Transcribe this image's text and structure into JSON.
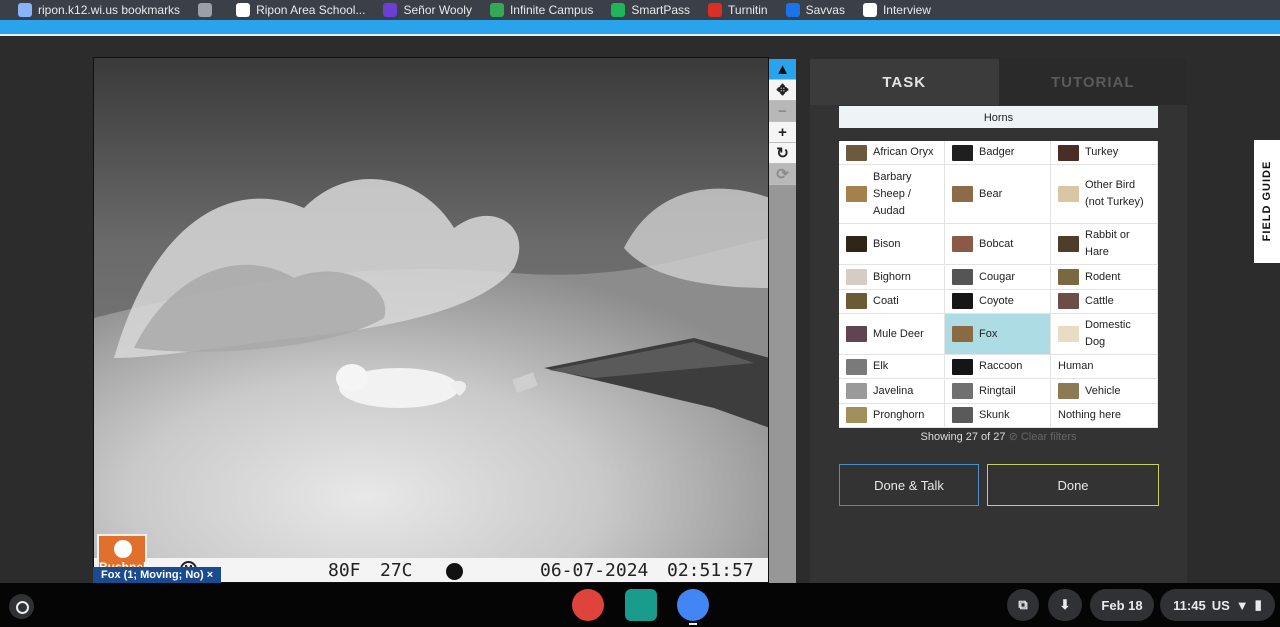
{
  "bookmarks": [
    {
      "label": "ripon.k12.wi.us bookmarks",
      "color": "#8ab4f8"
    },
    {
      "label": "",
      "color": "#9aa0a6"
    },
    {
      "label": "Ripon Area School...",
      "color": "#ffffff"
    },
    {
      "label": "Señor Wooly",
      "color": "#6a3fd2"
    },
    {
      "label": "Infinite Campus",
      "color": "#34a853"
    },
    {
      "label": "SmartPass",
      "color": "#1fb65a"
    },
    {
      "label": "Turnitin",
      "color": "#d93025"
    },
    {
      "label": "Savvas",
      "color": "#1a73e8"
    },
    {
      "label": "Interview",
      "color": "#ffffff"
    }
  ],
  "camera": {
    "temp_f": "80F",
    "temp_c": "27C",
    "date": "06-07-2024",
    "time": "02:51:57",
    "brand": "Bushnell"
  },
  "annotation_label": "Fox (1; Moving; No)",
  "tools": [
    {
      "icon": "pointer-icon",
      "glyph": "▲",
      "active": true
    },
    {
      "icon": "move-icon",
      "glyph": "✥",
      "active": false
    },
    {
      "icon": "zoom-out-icon",
      "glyph": "−",
      "active": false
    },
    {
      "icon": "zoom-in-icon",
      "glyph": "+",
      "active": false
    },
    {
      "icon": "rotate-icon",
      "glyph": "↻",
      "active": false
    },
    {
      "icon": "reset-icon",
      "glyph": "⟳",
      "active": false
    }
  ],
  "tabs": {
    "task": "TASK",
    "tutorial": "TUTORIAL"
  },
  "filter_label": "Horns",
  "species": [
    {
      "name": "African Oryx",
      "thumb": "#6b5a3e",
      "h": 1
    },
    {
      "name": "Badger",
      "thumb": "#1f1f1f",
      "h": 1
    },
    {
      "name": "Turkey",
      "thumb": "#4a2e25",
      "h": 1
    },
    {
      "name": "Barbary Sheep / Audad",
      "thumb": "#a3804c",
      "h": 3
    },
    {
      "name": "Bear",
      "thumb": "#8c6b48",
      "h": 3
    },
    {
      "name": "Other Bird (not Turkey)",
      "thumb": "#d9c7a4",
      "h": 3
    },
    {
      "name": "Bison",
      "thumb": "#2f2618",
      "h": 2
    },
    {
      "name": "Bobcat",
      "thumb": "#8a5a47",
      "h": 2
    },
    {
      "name": "Rabbit or Hare",
      "thumb": "#4e3d28",
      "h": 2
    },
    {
      "name": "Bighorn",
      "thumb": "#d7ccc4",
      "h": 1
    },
    {
      "name": "Cougar",
      "thumb": "#555555",
      "h": 1
    },
    {
      "name": "Rodent",
      "thumb": "#7a6840",
      "h": 1
    },
    {
      "name": "Coati",
      "thumb": "#6a5b36",
      "h": 1
    },
    {
      "name": "Coyote",
      "thumb": "#161616",
      "h": 1
    },
    {
      "name": "Cattle",
      "thumb": "#6d4d48",
      "h": 1
    },
    {
      "name": "Mule Deer",
      "thumb": "#5e4550",
      "h": 2
    },
    {
      "name": "Fox",
      "thumb": "#8a6a42",
      "h": 2,
      "selected": true
    },
    {
      "name": "Domestic Dog",
      "thumb": "#e8dcc2",
      "h": 2
    },
    {
      "name": "Elk",
      "thumb": "#7a7a7a",
      "h": 1
    },
    {
      "name": "Raccoon",
      "thumb": "#151515",
      "h": 1
    },
    {
      "name": "Human",
      "thumb": "",
      "h": 1
    },
    {
      "name": "Javelina",
      "thumb": "#9a9a9a",
      "h": 1
    },
    {
      "name": "Ringtail",
      "thumb": "#707070",
      "h": 1
    },
    {
      "name": "Vehicle",
      "thumb": "#8c7a55",
      "h": 1
    },
    {
      "name": "Pronghorn",
      "thumb": "#a38f5a",
      "h": 1
    },
    {
      "name": "Skunk",
      "thumb": "#5a5a5a",
      "h": 1
    },
    {
      "name": "Nothing here",
      "thumb": "",
      "h": 1
    }
  ],
  "showing": "Showing 27 of 27",
  "clear_filters": "Clear filters",
  "buttons": {
    "done_talk": "Done & Talk",
    "done": "Done"
  },
  "field_guide": "FIELD GUIDE",
  "shelf": {
    "apps": [
      {
        "icon": "palette-app-icon",
        "color": "#e0433a"
      },
      {
        "icon": "classroom-app-icon",
        "color": "#1a9c8c"
      },
      {
        "icon": "chrome-app-icon",
        "color": "#4285f4"
      }
    ],
    "date": "Feb 18",
    "time": "11:45",
    "locale": "US"
  }
}
